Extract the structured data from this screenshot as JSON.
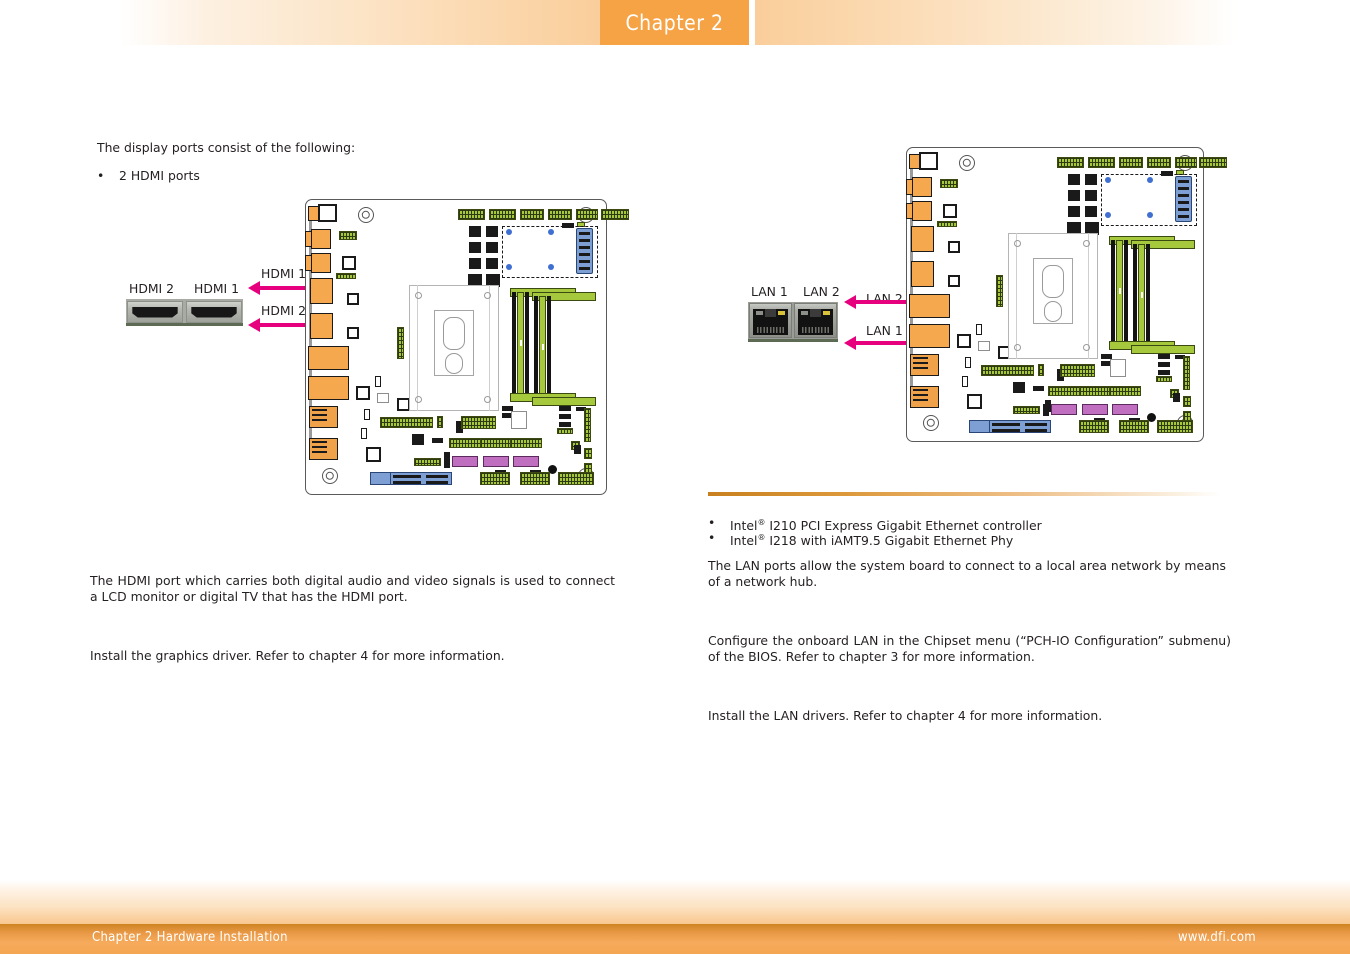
{
  "header": {
    "chapter_tab": "Chapter 2"
  },
  "footer": {
    "left": "Chapter 2 Hardware Installation",
    "right": "www.dfi.com"
  },
  "left_column": {
    "intro": "The display ports consist of the following:",
    "bullet_marker": "•",
    "bullet_hdmi": "2 HDMI ports",
    "photo_labels": {
      "hdmi2": "HDMI 2",
      "hdmi1": "HDMI 1"
    },
    "callouts": {
      "hdmi1": "HDMI 1",
      "hdmi2": "HDMI 2"
    },
    "description": "The HDMI port which carries both digital audio and video signals is used to connect a LCD monitor or digital TV that has the HDMI port.",
    "driver_note": "Install the graphics driver. Refer to chapter 4 for more information."
  },
  "right_column": {
    "photo_labels": {
      "lan1": "LAN 1",
      "lan2": "LAN 2"
    },
    "callouts": {
      "lan2": "LAN 2",
      "lan1": "LAN 1"
    },
    "bullet_marker": "•",
    "bullets": [
      {
        "pre": "Intel",
        "sup": "®",
        "post": " I210 PCI Express Gigabit Ethernet controller"
      },
      {
        "pre": "Intel",
        "sup": "®",
        "post": " I218 with iAMT9.5 Gigabit Ethernet Phy"
      }
    ],
    "description": "The LAN ports allow the system board to connect to a local area network by means of a network hub.",
    "bios_note": "Configure the onboard LAN in the Chipset menu (“PCH-IO Configuration” submenu) of the BIOS. Refer to chapter 3 for more information.",
    "driver_note": "Install the LAN drivers. Refer to chapter 4 for more information."
  },
  "colors": {
    "brand_orange": "#f6a346",
    "accent_magenta": "#e6007e",
    "board_orange": "#f5a84e",
    "board_green": "#a6c83c",
    "board_blue": "#7d9fd4",
    "board_purple": "#c06fc0",
    "footer_bar": "#f4a551"
  }
}
